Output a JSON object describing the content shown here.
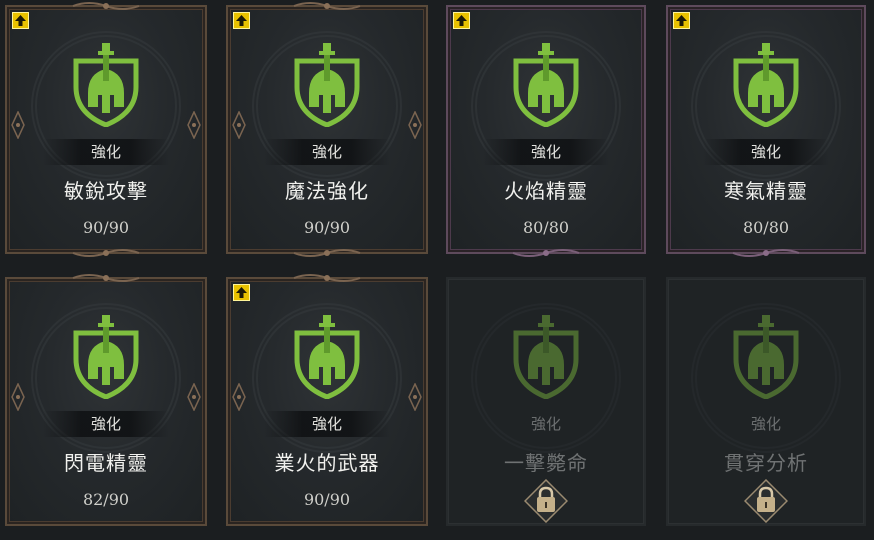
{
  "colors": {
    "emblem_green": "#7fbf3f",
    "upgrade_badge": "#e9c200",
    "frame_gold": "#5a4a3a",
    "frame_purple": "#5e4a5c"
  },
  "cards": [
    {
      "tag": "強化",
      "name": "敏銳攻擊",
      "count": "90/90",
      "upgrade_badge": true,
      "frame": "gold",
      "locked": false
    },
    {
      "tag": "強化",
      "name": "魔法強化",
      "count": "90/90",
      "upgrade_badge": true,
      "frame": "gold",
      "locked": false
    },
    {
      "tag": "強化",
      "name": "火焰精靈",
      "count": "80/80",
      "upgrade_badge": true,
      "frame": "purple",
      "locked": false
    },
    {
      "tag": "強化",
      "name": "寒氣精靈",
      "count": "80/80",
      "upgrade_badge": true,
      "frame": "purple",
      "locked": false
    },
    {
      "tag": "強化",
      "name": "閃電精靈",
      "count": "82/90",
      "upgrade_badge": false,
      "frame": "gold",
      "locked": false
    },
    {
      "tag": "強化",
      "name": "業火的武器",
      "count": "90/90",
      "upgrade_badge": true,
      "frame": "gold",
      "locked": false
    },
    {
      "tag": "強化",
      "name": "一擊斃命",
      "count": "",
      "upgrade_badge": false,
      "frame": "none",
      "locked": true
    },
    {
      "tag": "強化",
      "name": "貫穿分析",
      "count": "",
      "upgrade_badge": false,
      "frame": "none",
      "locked": true
    }
  ]
}
